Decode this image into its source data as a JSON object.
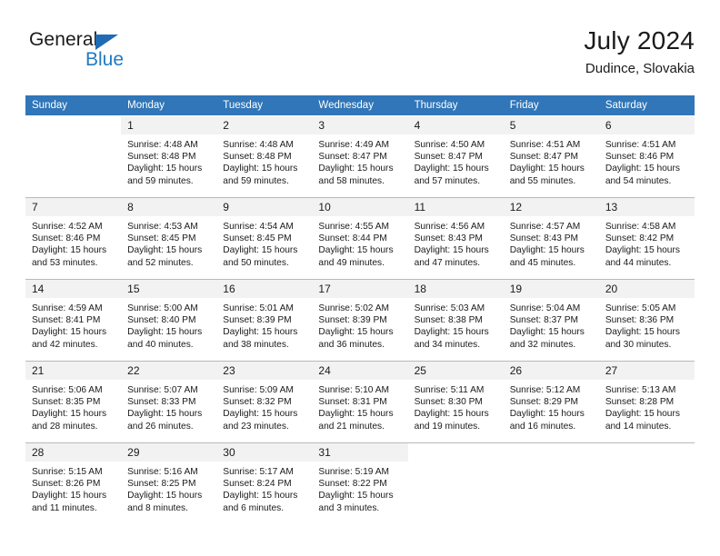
{
  "brand": {
    "name_part1": "General",
    "name_part2": "Blue",
    "flag_icon": "triangle-flag-icon",
    "colors": {
      "blue": "#1f7ac4",
      "flag_blue": "#1f6cb4",
      "dark": "#1a1a1a"
    }
  },
  "header": {
    "title": "July 2024",
    "subtitle": "Dudince, Slovakia"
  },
  "calendar": {
    "header_background": "#3076b8",
    "daynum_background": "#f2f2f2",
    "weekday_headers": [
      "Sunday",
      "Monday",
      "Tuesday",
      "Wednesday",
      "Thursday",
      "Friday",
      "Saturday"
    ],
    "weeks": [
      [
        {
          "day": "",
          "sunrise": "",
          "sunset": "",
          "daylight_line1": "",
          "daylight_line2": ""
        },
        {
          "day": "1",
          "sunrise": "Sunrise: 4:48 AM",
          "sunset": "Sunset: 8:48 PM",
          "daylight_line1": "Daylight: 15 hours",
          "daylight_line2": "and 59 minutes."
        },
        {
          "day": "2",
          "sunrise": "Sunrise: 4:48 AM",
          "sunset": "Sunset: 8:48 PM",
          "daylight_line1": "Daylight: 15 hours",
          "daylight_line2": "and 59 minutes."
        },
        {
          "day": "3",
          "sunrise": "Sunrise: 4:49 AM",
          "sunset": "Sunset: 8:47 PM",
          "daylight_line1": "Daylight: 15 hours",
          "daylight_line2": "and 58 minutes."
        },
        {
          "day": "4",
          "sunrise": "Sunrise: 4:50 AM",
          "sunset": "Sunset: 8:47 PM",
          "daylight_line1": "Daylight: 15 hours",
          "daylight_line2": "and 57 minutes."
        },
        {
          "day": "5",
          "sunrise": "Sunrise: 4:51 AM",
          "sunset": "Sunset: 8:47 PM",
          "daylight_line1": "Daylight: 15 hours",
          "daylight_line2": "and 55 minutes."
        },
        {
          "day": "6",
          "sunrise": "Sunrise: 4:51 AM",
          "sunset": "Sunset: 8:46 PM",
          "daylight_line1": "Daylight: 15 hours",
          "daylight_line2": "and 54 minutes."
        }
      ],
      [
        {
          "day": "7",
          "sunrise": "Sunrise: 4:52 AM",
          "sunset": "Sunset: 8:46 PM",
          "daylight_line1": "Daylight: 15 hours",
          "daylight_line2": "and 53 minutes."
        },
        {
          "day": "8",
          "sunrise": "Sunrise: 4:53 AM",
          "sunset": "Sunset: 8:45 PM",
          "daylight_line1": "Daylight: 15 hours",
          "daylight_line2": "and 52 minutes."
        },
        {
          "day": "9",
          "sunrise": "Sunrise: 4:54 AM",
          "sunset": "Sunset: 8:45 PM",
          "daylight_line1": "Daylight: 15 hours",
          "daylight_line2": "and 50 minutes."
        },
        {
          "day": "10",
          "sunrise": "Sunrise: 4:55 AM",
          "sunset": "Sunset: 8:44 PM",
          "daylight_line1": "Daylight: 15 hours",
          "daylight_line2": "and 49 minutes."
        },
        {
          "day": "11",
          "sunrise": "Sunrise: 4:56 AM",
          "sunset": "Sunset: 8:43 PM",
          "daylight_line1": "Daylight: 15 hours",
          "daylight_line2": "and 47 minutes."
        },
        {
          "day": "12",
          "sunrise": "Sunrise: 4:57 AM",
          "sunset": "Sunset: 8:43 PM",
          "daylight_line1": "Daylight: 15 hours",
          "daylight_line2": "and 45 minutes."
        },
        {
          "day": "13",
          "sunrise": "Sunrise: 4:58 AM",
          "sunset": "Sunset: 8:42 PM",
          "daylight_line1": "Daylight: 15 hours",
          "daylight_line2": "and 44 minutes."
        }
      ],
      [
        {
          "day": "14",
          "sunrise": "Sunrise: 4:59 AM",
          "sunset": "Sunset: 8:41 PM",
          "daylight_line1": "Daylight: 15 hours",
          "daylight_line2": "and 42 minutes."
        },
        {
          "day": "15",
          "sunrise": "Sunrise: 5:00 AM",
          "sunset": "Sunset: 8:40 PM",
          "daylight_line1": "Daylight: 15 hours",
          "daylight_line2": "and 40 minutes."
        },
        {
          "day": "16",
          "sunrise": "Sunrise: 5:01 AM",
          "sunset": "Sunset: 8:39 PM",
          "daylight_line1": "Daylight: 15 hours",
          "daylight_line2": "and 38 minutes."
        },
        {
          "day": "17",
          "sunrise": "Sunrise: 5:02 AM",
          "sunset": "Sunset: 8:39 PM",
          "daylight_line1": "Daylight: 15 hours",
          "daylight_line2": "and 36 minutes."
        },
        {
          "day": "18",
          "sunrise": "Sunrise: 5:03 AM",
          "sunset": "Sunset: 8:38 PM",
          "daylight_line1": "Daylight: 15 hours",
          "daylight_line2": "and 34 minutes."
        },
        {
          "day": "19",
          "sunrise": "Sunrise: 5:04 AM",
          "sunset": "Sunset: 8:37 PM",
          "daylight_line1": "Daylight: 15 hours",
          "daylight_line2": "and 32 minutes."
        },
        {
          "day": "20",
          "sunrise": "Sunrise: 5:05 AM",
          "sunset": "Sunset: 8:36 PM",
          "daylight_line1": "Daylight: 15 hours",
          "daylight_line2": "and 30 minutes."
        }
      ],
      [
        {
          "day": "21",
          "sunrise": "Sunrise: 5:06 AM",
          "sunset": "Sunset: 8:35 PM",
          "daylight_line1": "Daylight: 15 hours",
          "daylight_line2": "and 28 minutes."
        },
        {
          "day": "22",
          "sunrise": "Sunrise: 5:07 AM",
          "sunset": "Sunset: 8:33 PM",
          "daylight_line1": "Daylight: 15 hours",
          "daylight_line2": "and 26 minutes."
        },
        {
          "day": "23",
          "sunrise": "Sunrise: 5:09 AM",
          "sunset": "Sunset: 8:32 PM",
          "daylight_line1": "Daylight: 15 hours",
          "daylight_line2": "and 23 minutes."
        },
        {
          "day": "24",
          "sunrise": "Sunrise: 5:10 AM",
          "sunset": "Sunset: 8:31 PM",
          "daylight_line1": "Daylight: 15 hours",
          "daylight_line2": "and 21 minutes."
        },
        {
          "day": "25",
          "sunrise": "Sunrise: 5:11 AM",
          "sunset": "Sunset: 8:30 PM",
          "daylight_line1": "Daylight: 15 hours",
          "daylight_line2": "and 19 minutes."
        },
        {
          "day": "26",
          "sunrise": "Sunrise: 5:12 AM",
          "sunset": "Sunset: 8:29 PM",
          "daylight_line1": "Daylight: 15 hours",
          "daylight_line2": "and 16 minutes."
        },
        {
          "day": "27",
          "sunrise": "Sunrise: 5:13 AM",
          "sunset": "Sunset: 8:28 PM",
          "daylight_line1": "Daylight: 15 hours",
          "daylight_line2": "and 14 minutes."
        }
      ],
      [
        {
          "day": "28",
          "sunrise": "Sunrise: 5:15 AM",
          "sunset": "Sunset: 8:26 PM",
          "daylight_line1": "Daylight: 15 hours",
          "daylight_line2": "and 11 minutes."
        },
        {
          "day": "29",
          "sunrise": "Sunrise: 5:16 AM",
          "sunset": "Sunset: 8:25 PM",
          "daylight_line1": "Daylight: 15 hours",
          "daylight_line2": "and 8 minutes."
        },
        {
          "day": "30",
          "sunrise": "Sunrise: 5:17 AM",
          "sunset": "Sunset: 8:24 PM",
          "daylight_line1": "Daylight: 15 hours",
          "daylight_line2": "and 6 minutes."
        },
        {
          "day": "31",
          "sunrise": "Sunrise: 5:19 AM",
          "sunset": "Sunset: 8:22 PM",
          "daylight_line1": "Daylight: 15 hours",
          "daylight_line2": "and 3 minutes."
        },
        {
          "day": "",
          "sunrise": "",
          "sunset": "",
          "daylight_line1": "",
          "daylight_line2": ""
        },
        {
          "day": "",
          "sunrise": "",
          "sunset": "",
          "daylight_line1": "",
          "daylight_line2": ""
        },
        {
          "day": "",
          "sunrise": "",
          "sunset": "",
          "daylight_line1": "",
          "daylight_line2": ""
        }
      ]
    ]
  }
}
